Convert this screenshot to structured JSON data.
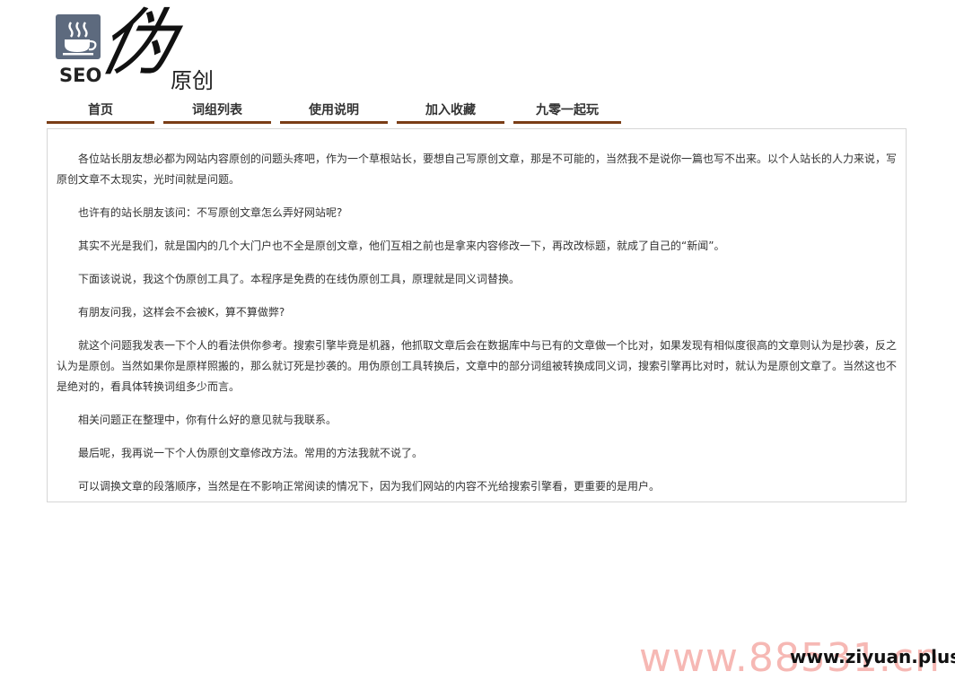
{
  "logo": {
    "seo": "SEO",
    "wei": "伪",
    "yuanchuang": "原创",
    "icon": "coffee-cup-icon"
  },
  "nav": {
    "items": [
      {
        "label": "首页"
      },
      {
        "label": "词组列表"
      },
      {
        "label": "使用说明"
      },
      {
        "label": "加入收藏"
      },
      {
        "label": "九零一起玩"
      }
    ]
  },
  "content": {
    "paragraphs": [
      "各位站长朋友想必都为网站内容原创的问题头疼吧，作为一个草根站长，要想自己写原创文章，那是不可能的，当然我不是说你一篇也写不出来。以个人站长的人力来说，写原创文章不太现实，光时间就是问题。",
      "也许有的站长朋友该问：不写原创文章怎么弄好网站呢?",
      "其实不光是我们，就是国内的几个大门户也不全是原创文章，他们互相之前也是拿来内容修改一下，再改改标题，就成了自己的“新闻”。",
      "下面该说说，我这个伪原创工具了。本程序是免费的在线伪原创工具，原理就是同义词替换。",
      "有朋友问我，这样会不会被K，算不算做弊?",
      "就这个问题我发表一下个人的看法供你参考。搜索引擎毕竟是机器，他抓取文章后会在数据库中与已有的文章做一个比对，如果发现有相似度很高的文章则认为是抄袭，反之认为是原创。当然如果你是原样照搬的，那么就订死是抄袭的。用伪原创工具转换后，文章中的部分词组被转换成同义词，搜索引擎再比对时，就认为是原创文章了。当然这也不是绝对的，看具体转换词组多少而言。",
      "相关问题正在整理中，你有什么好的意见就与我联系。",
      "最后呢，我再说一下个人伪原创文章修改方法。常用的方法我就不说了。",
      "可以调换文章的段落顺序，当然是在不影响正常阅读的情况下，因为我们网站的内容不光给搜索引擎看，更重要的是用户。"
    ]
  },
  "watermark": {
    "back": "www.88531.cn",
    "front": "www.ziyuan.plus"
  },
  "colors": {
    "nav_underline": "#7a3d16",
    "logo_icon_bg": "#5d6a7e",
    "content_border": "#d6d6d6",
    "watermark_back": "#f6b8b4"
  }
}
